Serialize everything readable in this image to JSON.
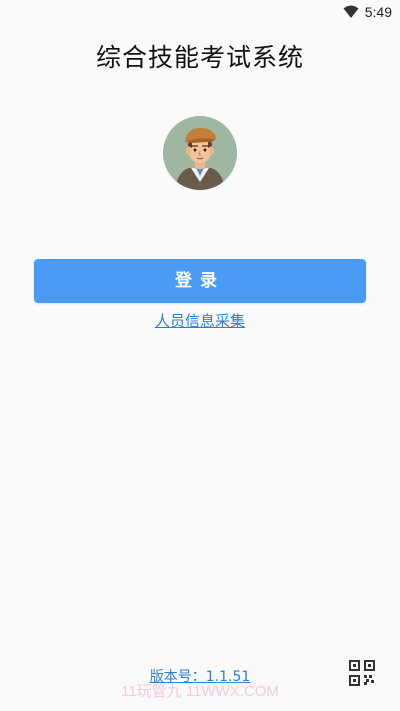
{
  "status_bar": {
    "time": "5:49",
    "wifi_icon": "wifi-icon"
  },
  "app": {
    "title": "综合技能考试系统"
  },
  "avatar": {
    "icon": "avatar-cartoon-man"
  },
  "login": {
    "button_label": "登录"
  },
  "links": {
    "personnel_collection": "人员信息采集",
    "version": "版本号：1.1.51"
  },
  "watermark": {
    "text": "11玩管九 11WWX.COM"
  },
  "qr": {
    "icon": "qr-code-icon"
  },
  "colors": {
    "accent": "#4a9bf5",
    "link": "#2a7fd4",
    "background": "#fafafa"
  }
}
